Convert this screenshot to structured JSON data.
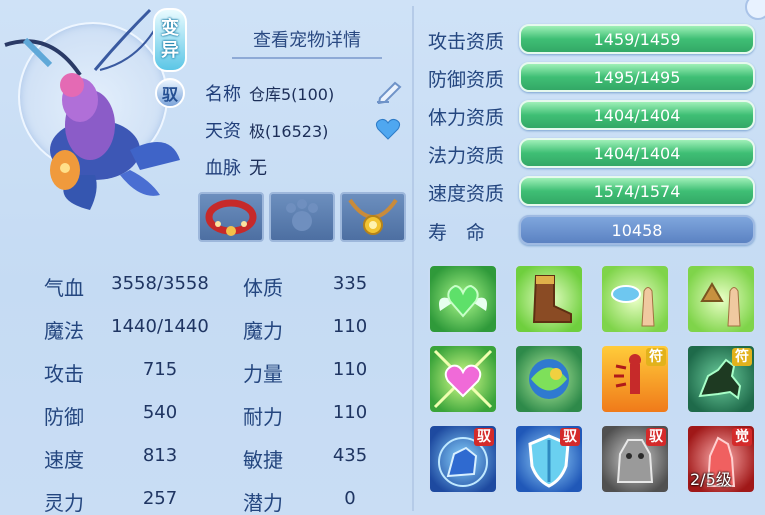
{
  "header": {
    "title": "查看宠物详情"
  },
  "badges": {
    "variant_line1": "变",
    "variant_line2": "异",
    "yu": "驭"
  },
  "info": {
    "name_label": "名称",
    "name_value": "仓库5(100)",
    "talent_label": "天资",
    "talent_value": "极(16523)",
    "bloodline_label": "血脉",
    "bloodline_value": "无"
  },
  "stats": [
    {
      "label": "气血",
      "value": "3558/3558"
    },
    {
      "label": "魔法",
      "value": "1440/1440"
    },
    {
      "label": "攻击",
      "value": "715"
    },
    {
      "label": "防御",
      "value": "540"
    },
    {
      "label": "速度",
      "value": "813"
    },
    {
      "label": "灵力",
      "value": "257"
    }
  ],
  "points": [
    {
      "label": "体质",
      "value": "335"
    },
    {
      "label": "魔力",
      "value": "110"
    },
    {
      "label": "力量",
      "value": "110"
    },
    {
      "label": "耐力",
      "value": "110"
    },
    {
      "label": "敏捷",
      "value": "435"
    },
    {
      "label": "潜力",
      "value": "0"
    }
  ],
  "aptitudes": [
    {
      "label": "攻击资质",
      "value": "1459/1459"
    },
    {
      "label": "防御资质",
      "value": "1495/1495"
    },
    {
      "label": "体力资质",
      "value": "1404/1404"
    },
    {
      "label": "法力资质",
      "value": "1404/1404"
    },
    {
      "label": "速度资质",
      "value": "1574/1574"
    }
  ],
  "lifespan": {
    "label": "寿　命",
    "value": "10458"
  },
  "skills": [
    {
      "icon": "green-heart-wings-icon",
      "tag": ""
    },
    {
      "icon": "boot-icon",
      "tag": ""
    },
    {
      "icon": "water-hand-icon",
      "tag": ""
    },
    {
      "icon": "earth-hand-icon",
      "tag": ""
    },
    {
      "icon": "pink-heart-icon",
      "tag": ""
    },
    {
      "icon": "swirl-orb-icon",
      "tag": ""
    },
    {
      "icon": "fire-figure-icon",
      "tag": "符"
    },
    {
      "icon": "horse-icon",
      "tag": "符"
    },
    {
      "icon": "blue-beast-icon",
      "tag": "驭"
    },
    {
      "icon": "shield-icon",
      "tag": "驭"
    },
    {
      "icon": "stone-beast-icon",
      "tag": "驭"
    },
    {
      "icon": "red-demon-icon",
      "tag": "觉",
      "level": "2/5级"
    }
  ],
  "colors": {
    "aptitude_bar": "#3fbf75",
    "life_bar": "#5b82c2",
    "tag_red": "#d42a2a"
  }
}
